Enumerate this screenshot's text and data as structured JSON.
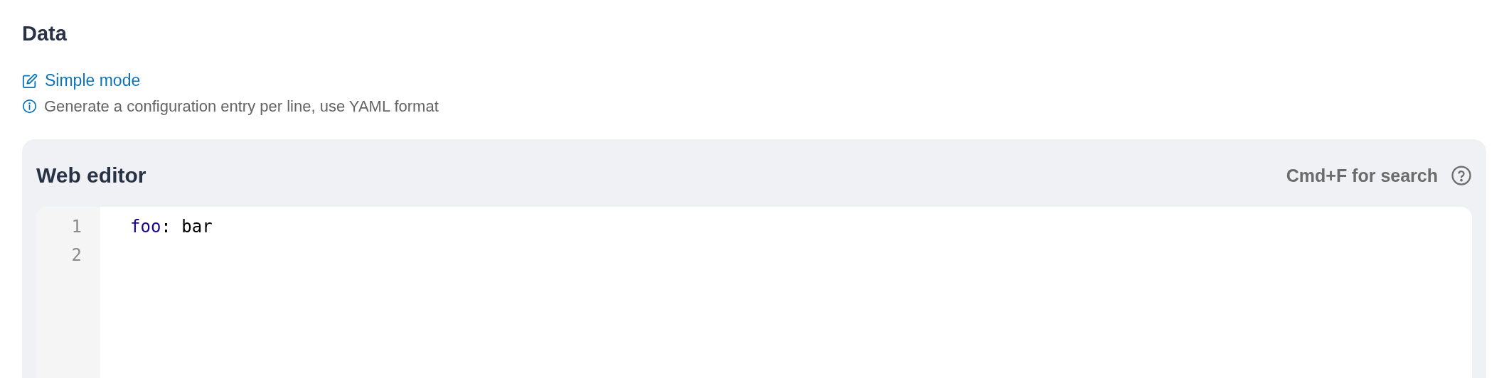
{
  "section_title": "Data",
  "mode_link": {
    "label": "Simple mode"
  },
  "hint": "Generate a configuration entry per line, use YAML format",
  "editor": {
    "title": "Web editor",
    "search_hint": "Cmd+F for search",
    "lines": [
      {
        "number": "1",
        "tokens": [
          {
            "kind": "key",
            "text": "foo"
          },
          {
            "kind": "plain",
            "text": ": bar"
          }
        ]
      },
      {
        "number": "2"
      }
    ]
  }
}
